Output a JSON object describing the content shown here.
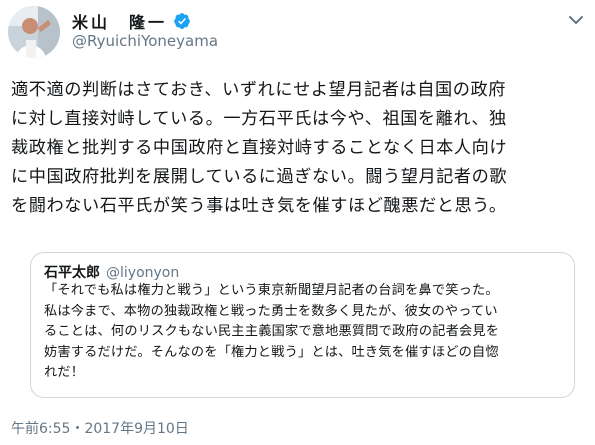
{
  "author": {
    "name": "米山　隆一",
    "handle": "@RyuichiYoneyama",
    "verified": true
  },
  "tweet": {
    "text": "適不適の判断はさておき、いずれにせよ望月記者は自国の政府\nに対し直接対峙している。一方石平氏は今や、祖国を離れ、独\n裁政権と批判する中国政府と直接対峙することなく日本人向け\nに中国政府批判を展開しているに過ぎない。闘う望月記者の歌\nを闘わない石平氏が笑う事は吐き気を催すほど醜悪だと思う。",
    "timestamp": "午前6:55・2017年9月10日"
  },
  "quoted_tweet": {
    "name": "石平太郎",
    "handle": "@liyonyon",
    "text": "「それでも私は権力と戦う」という東京新聞望月記者の台詞を鼻で笑った。\n私は今まで、本物の独裁政権と戦った勇士を数多く見たが、彼女のやってい\nることは、何のリスクもない民主主義国家で意地悪質問で政府の記者会見を\n妨害するだけだ。そんなのを「権力と戦う」とは、吐き気を催すほどの自惚\nれだ！"
  },
  "colors": {
    "text": "#14171a",
    "secondary": "#657786",
    "verified": "#1da1f2",
    "border": "#ccd6dd"
  },
  "icons": [
    "avatar",
    "verified-badge-icon",
    "chevron-down-icon"
  ]
}
